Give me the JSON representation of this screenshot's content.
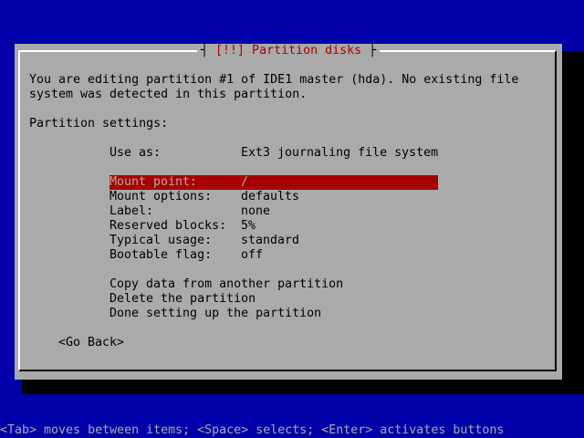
{
  "dialog": {
    "title": "[!!] Partition disks",
    "intro_line1": "You are editing partition #1 of IDE1 master (hda). No existing file",
    "intro_line2": "system was detected in this partition.",
    "settings_header": "Partition settings:",
    "use_as": {
      "label": "Use as:",
      "value": "Ext3 journaling file system"
    },
    "options": [
      {
        "label": "Mount point:",
        "value": "/"
      },
      {
        "label": "Mount options:",
        "value": "defaults"
      },
      {
        "label": "Label:",
        "value": "none"
      },
      {
        "label": "Reserved blocks:",
        "value": "5%"
      },
      {
        "label": "Typical usage:",
        "value": "standard"
      },
      {
        "label": "Bootable flag:",
        "value": "off"
      }
    ],
    "actions": [
      "Copy data from another partition",
      "Delete the partition",
      "Done setting up the partition"
    ],
    "go_back": "<Go Back>"
  },
  "footer": {
    "help": "<Tab> moves between items; <Space> selects; <Enter> activates buttons"
  },
  "colors": {
    "background": "#0000a8",
    "dialog": "#aaaaaa",
    "highlight": "#a80000"
  }
}
